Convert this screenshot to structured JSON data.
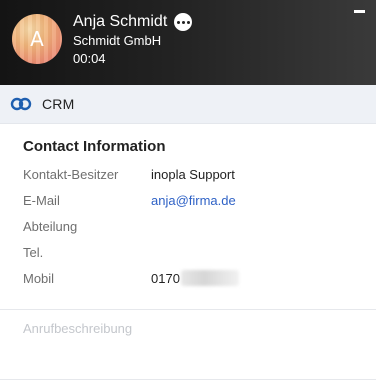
{
  "call": {
    "avatar_initial": "A",
    "caller_name": "Anja Schmidt",
    "company": "Schmidt GmbH",
    "timer": "00:04"
  },
  "crm": {
    "title": "CRM"
  },
  "contact": {
    "section_title": "Contact Information",
    "rows": [
      {
        "label": "Kontakt-Besitzer",
        "value": "inopla Support"
      },
      {
        "label": "E-Mail",
        "value": "anja@firma.de"
      },
      {
        "label": "Abteilung",
        "value": ""
      },
      {
        "label": "Tel.",
        "value": ""
      },
      {
        "label": "Mobil",
        "value": "0170"
      }
    ]
  },
  "description": {
    "placeholder": "Anrufbeschreibung"
  },
  "colors": {
    "link": "#2f62c6",
    "crm_icon": "#1f5fb0",
    "crm_bar_bg": "#eef1f6"
  }
}
